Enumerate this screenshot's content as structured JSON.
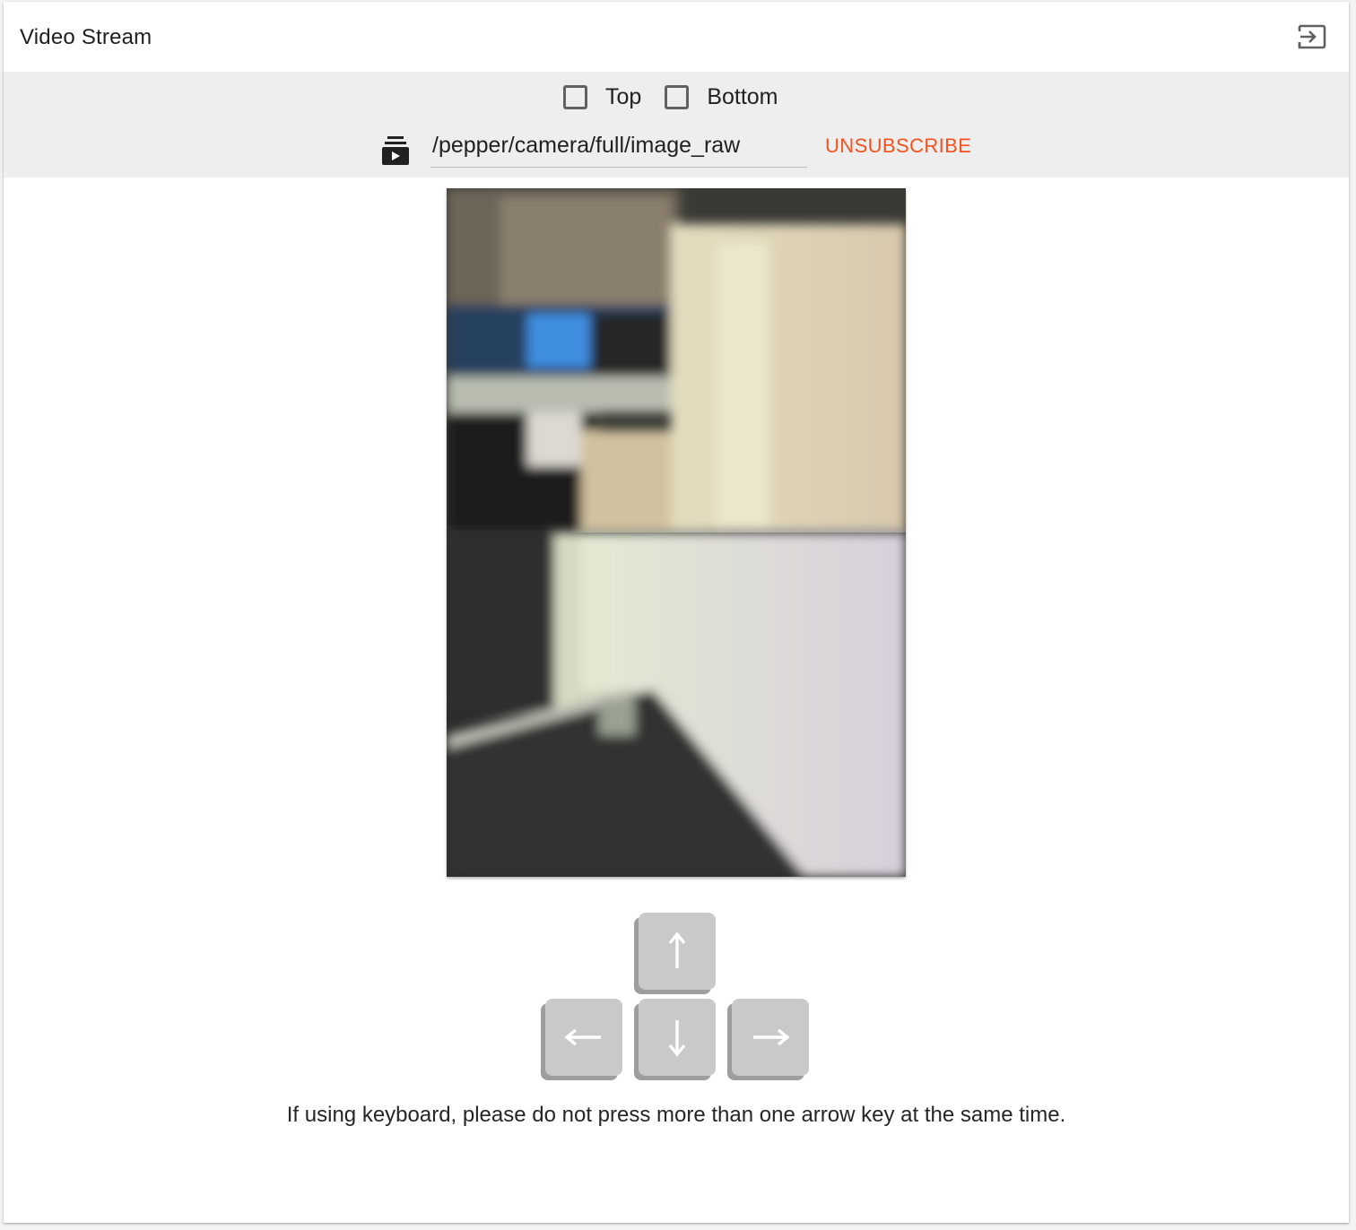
{
  "panel": {
    "title": "Video Stream",
    "exit_icon": "exit-to-app-icon"
  },
  "camera_toggles": [
    {
      "label": "Top",
      "checked": false
    },
    {
      "label": "Bottom",
      "checked": false
    }
  ],
  "topic": {
    "icon": "subscriptions-icon",
    "value": "/pepper/camera/full/image_raw",
    "unsubscribe_label": "UNSUBSCRIBE",
    "accent_color": "#f4511e"
  },
  "video": {
    "description_icon": "camera-frame"
  },
  "arrow_keys": {
    "up": "arrow-up-icon",
    "left": "arrow-left-icon",
    "down": "arrow-down-icon",
    "right": "arrow-right-icon"
  },
  "note": "If using keyboard, please do not press more than one arrow key at the same time."
}
